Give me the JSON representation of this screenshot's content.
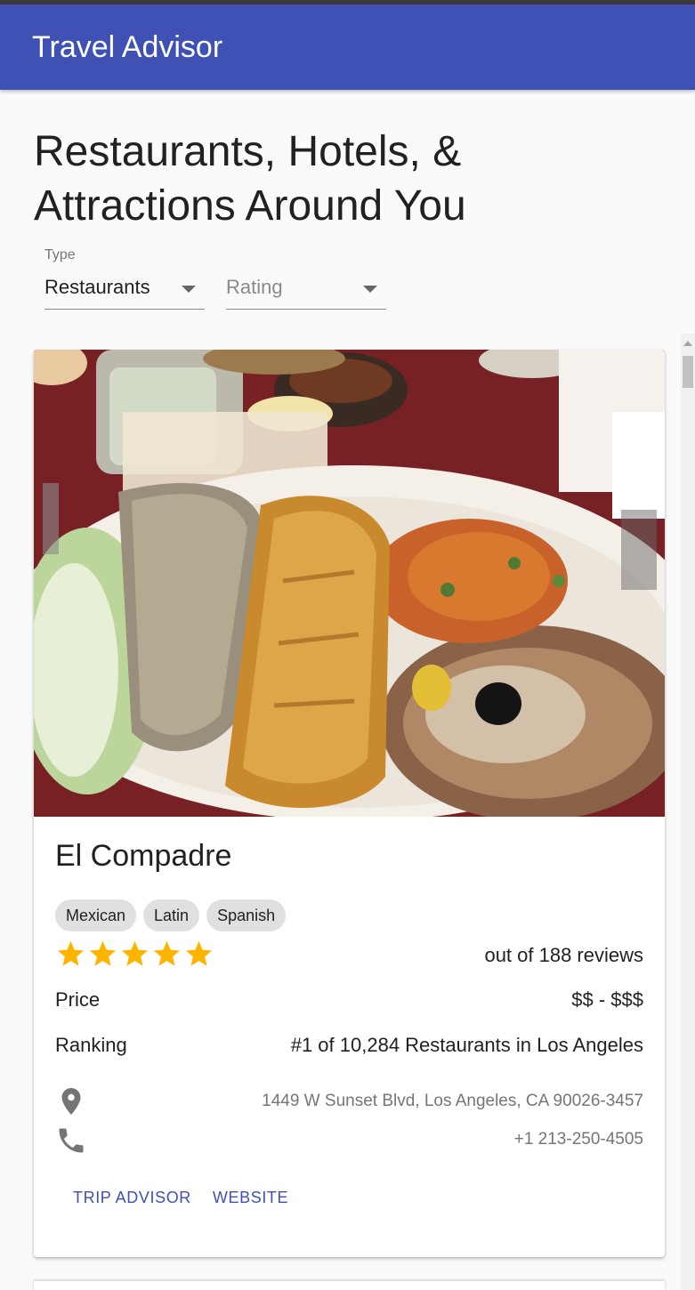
{
  "app": {
    "title": "Travel Advisor"
  },
  "heading": "Restaurants, Hotels, & Attractions Around You",
  "filters": {
    "type": {
      "label": "Type",
      "value": "Restaurants"
    },
    "rating": {
      "placeholder": "Rating"
    }
  },
  "place": {
    "name": "El Compadre",
    "cuisines": [
      "Mexican",
      "Latin",
      "Spanish"
    ],
    "rating": 5,
    "rating_max": 5,
    "reviews_text": "out of 188 reviews",
    "price_label": "Price",
    "price": "$$ - $$$",
    "ranking_label": "Ranking",
    "ranking": "#1 of 10,284 Restaurants in Los Angeles",
    "address": "1449 W Sunset Blvd, Los Angeles, CA 90026-3457",
    "phone": "+1 213-250-4505",
    "actions": {
      "trip_advisor": "TRIP ADVISOR",
      "website": "WEBSITE"
    }
  },
  "colors": {
    "appbar": "#3f51b5",
    "link": "#3f51b5",
    "star": "#ffb400",
    "chip": "#e0e0e0"
  },
  "icons": {
    "address": "location-pin-icon",
    "phone": "phone-icon",
    "star": "star-icon"
  }
}
